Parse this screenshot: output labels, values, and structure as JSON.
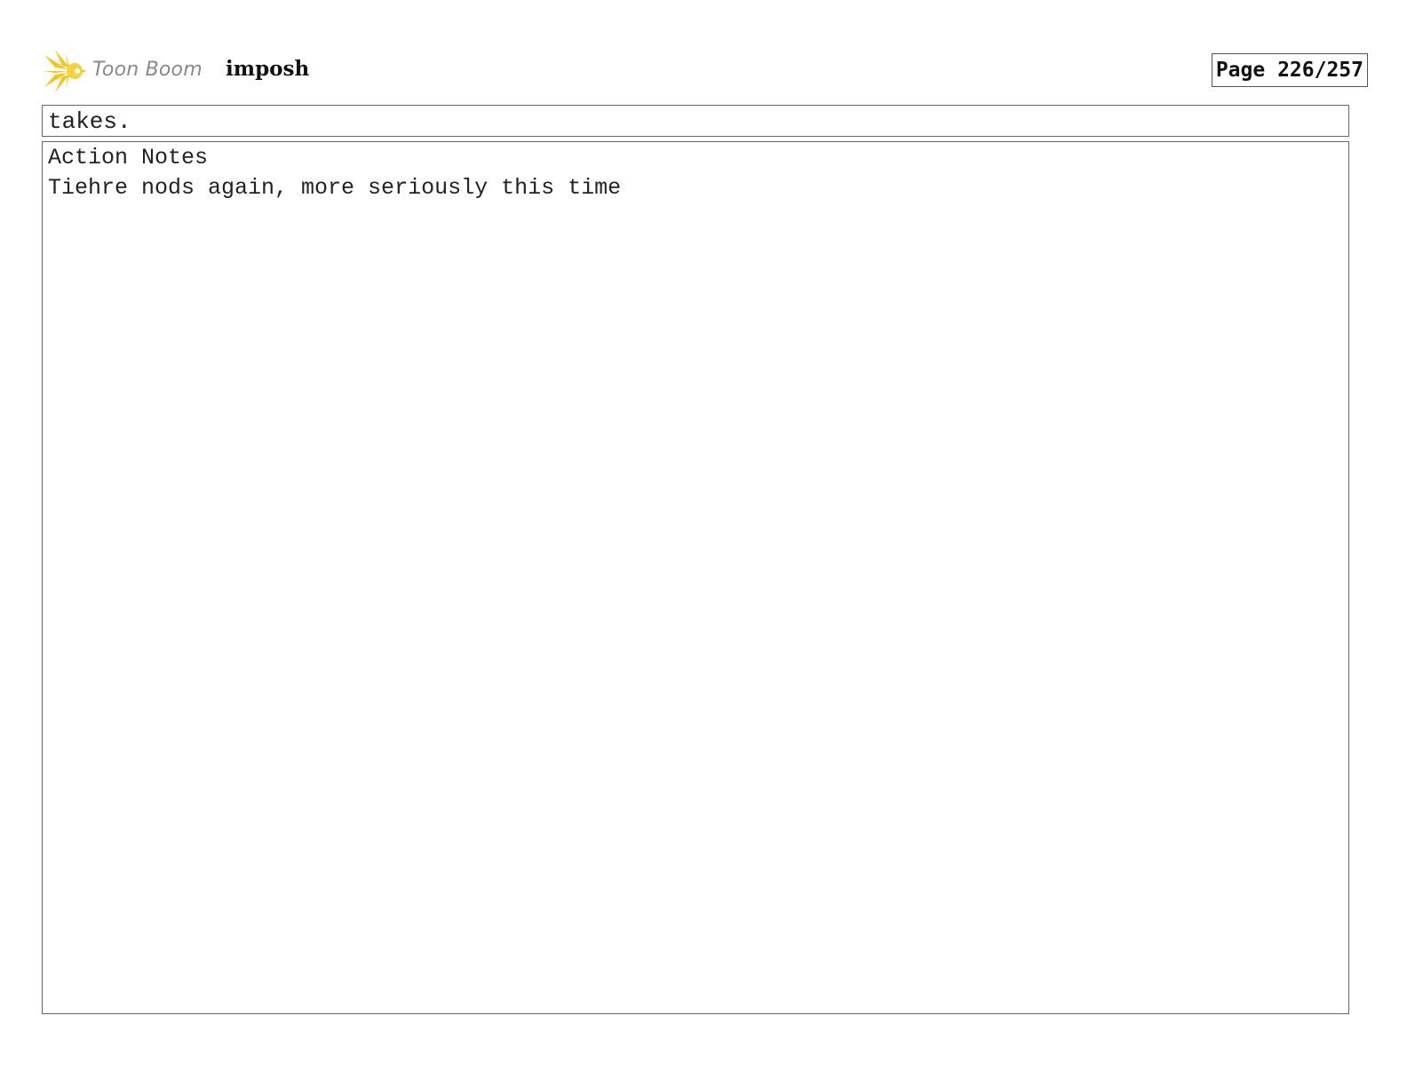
{
  "header": {
    "logo_text": "Toon Boom",
    "project_name": "imposh",
    "page_label": "Page 226/257"
  },
  "dialogue": {
    "text": "takes."
  },
  "notes": {
    "label": "Action Notes",
    "text": "Tiehre nods again, more seriously this time"
  },
  "colors": {
    "logo_star": "#f5c518",
    "logo_text": "#8a8a8a",
    "border": "#666666"
  }
}
